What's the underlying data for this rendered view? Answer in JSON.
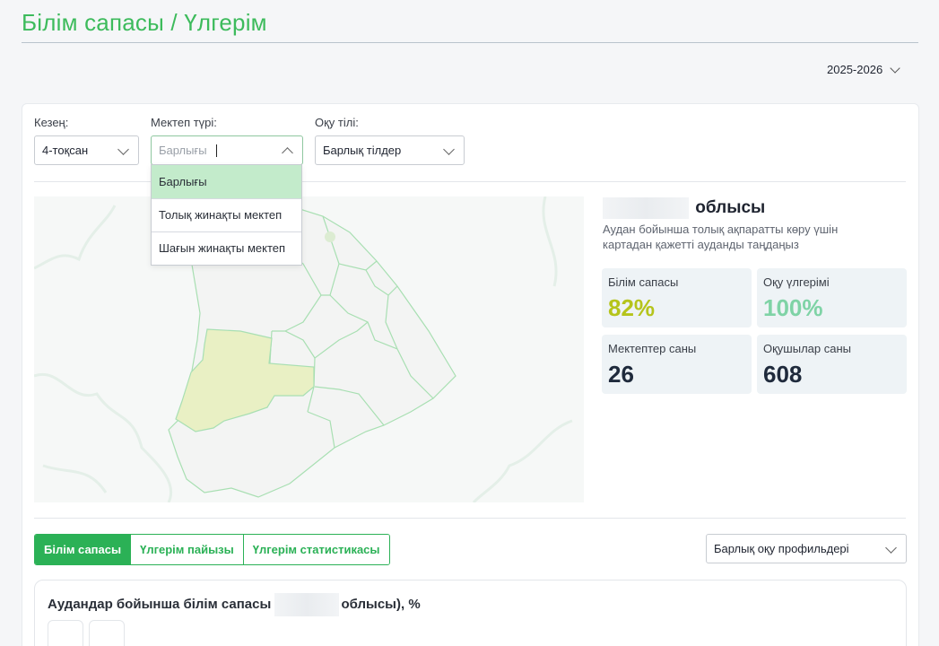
{
  "header": {
    "title": "Білім сапасы / Үлгерім",
    "year": "2025-2026"
  },
  "filters": {
    "period": {
      "label": "Кезең:",
      "value": "4-тоқсан"
    },
    "school_type": {
      "label": "Мектеп түрі:",
      "placeholder": "Барлығы",
      "options": [
        "Барлығы",
        "Толық жинақты мектеп",
        "Шағын жинақты мектеп"
      ],
      "selected": "Барлығы"
    },
    "language": {
      "label": "Оқу тілі:",
      "value": "Барлық тілдер"
    }
  },
  "region": {
    "title_suffix": "облысы",
    "hint": "Аудан бойынша толық ақпаратты көру үшін картадан қажетті ауданды таңдаңыз"
  },
  "stats": [
    {
      "label": "Білім сапасы",
      "value": "82%",
      "color": "#b5c41b"
    },
    {
      "label": "Оқу үлгерімі",
      "value": "100%",
      "color": "#7fd3a6"
    },
    {
      "label": "Мектептер саны",
      "value": "26",
      "color": "#1f2a3c"
    },
    {
      "label": "Оқушылар саны",
      "value": "608",
      "color": "#1f2a3c"
    }
  ],
  "tabs": [
    "Білім сапасы",
    "Үлгерім пайызы",
    "Үлгерім статистикасы"
  ],
  "active_tab": 0,
  "profile_select": {
    "value": "Барлық оқу профильдері"
  },
  "chart": {
    "title_prefix": "Аудандар бойынша білім сапасы",
    "title_suffix": "облысы), %"
  },
  "colors": {
    "brand_green": "#2bb156",
    "title_green": "#3dbb5c",
    "highlight_district": "#e9f0c4",
    "map_border": "#a8dfb2"
  }
}
